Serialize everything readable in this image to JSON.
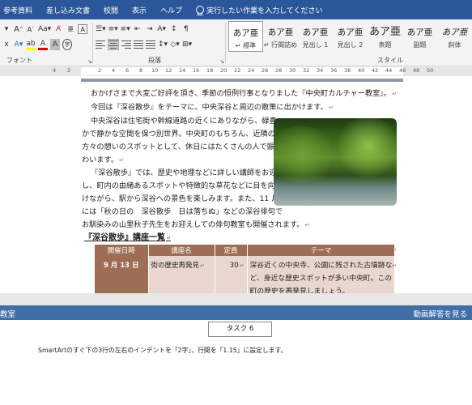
{
  "menu": {
    "items": [
      "参考資料",
      "差し込み文書",
      "校閲",
      "表示",
      "ヘルプ"
    ],
    "tell_me": "実行したい作業を入力してください"
  },
  "ribbon": {
    "font_group_label": "フォント",
    "paragraph_group_label": "段落",
    "style_group_label": "スタイル",
    "styles": [
      {
        "preview": "あア亜",
        "name": "↵ 標準"
      },
      {
        "preview": "あア亜",
        "name": "↵ 行間詰め"
      },
      {
        "preview": "あア亜",
        "name": "見出し 1"
      },
      {
        "preview": "あア亜",
        "name": "見出し 2"
      },
      {
        "preview": "あア亜",
        "name": "表題"
      },
      {
        "preview": "あア亜",
        "name": "副題"
      },
      {
        "preview": "あア亜",
        "name": "斜体"
      }
    ]
  },
  "ruler": {
    "numbers": [
      "4",
      "2",
      "2",
      "4",
      "6",
      "8",
      "10",
      "12",
      "14",
      "16",
      "18",
      "20",
      "22",
      "24",
      "26",
      "28",
      "30",
      "32",
      "34",
      "36",
      "38",
      "40",
      "42",
      "44",
      "46",
      "48",
      "50"
    ]
  },
  "document": {
    "paragraphs": [
      "おかげさまで大変ご好評を頂き、季節の恒例行事となりました『中央町カルチャー教室』。",
      "今回は『深谷散歩』をテーマに、中央深谷と周辺の散策に出かけます。",
      "中央深谷は住宅街や幹線道路の近くにありながら、緑豊",
      "かで静かな空間を保つ別世界。中央町のもちろん、近隣の",
      "方々の憩いのスポットとして、休日にはたくさんの人で賑",
      "わいます。",
      "『深谷散歩』では、歴史や地理などに詳しい講師をお迎え",
      "し、町内の由緒あるスポットや特徴的な草花などに目を向",
      "けながら、駅から深谷への景色を楽しみます。また、11 月",
      "には「秋の日の　深谷散歩　日は落ちぬ」などの深谷俳句で",
      "お馴染みの山里秋子先生をお迎えしての俳句教室も開催されます。"
    ],
    "section_title": "『深谷散歩』講座一覧",
    "table": {
      "headers": [
        "開催日時",
        "講座名",
        "定員",
        "テーマ"
      ],
      "rows": [
        {
          "date": "9 月 13 日",
          "name": "街の歴史再発見",
          "capacity": "30",
          "theme_lines": [
            "深谷近くの中央寺、公園に残された古墳跡な",
            "ど、身近な歴史スポットが多い中央町。この",
            "町の歴史を再発見しましょう。"
          ]
        }
      ]
    }
  },
  "bottom": {
    "left_label": "教室",
    "right_label": "動画解答を見る",
    "task_label": "タスク 6",
    "instruction": "SmartArtのすぐ下の3行の左右のインデントを「2字」、行間を「1.15」に設定します。"
  }
}
